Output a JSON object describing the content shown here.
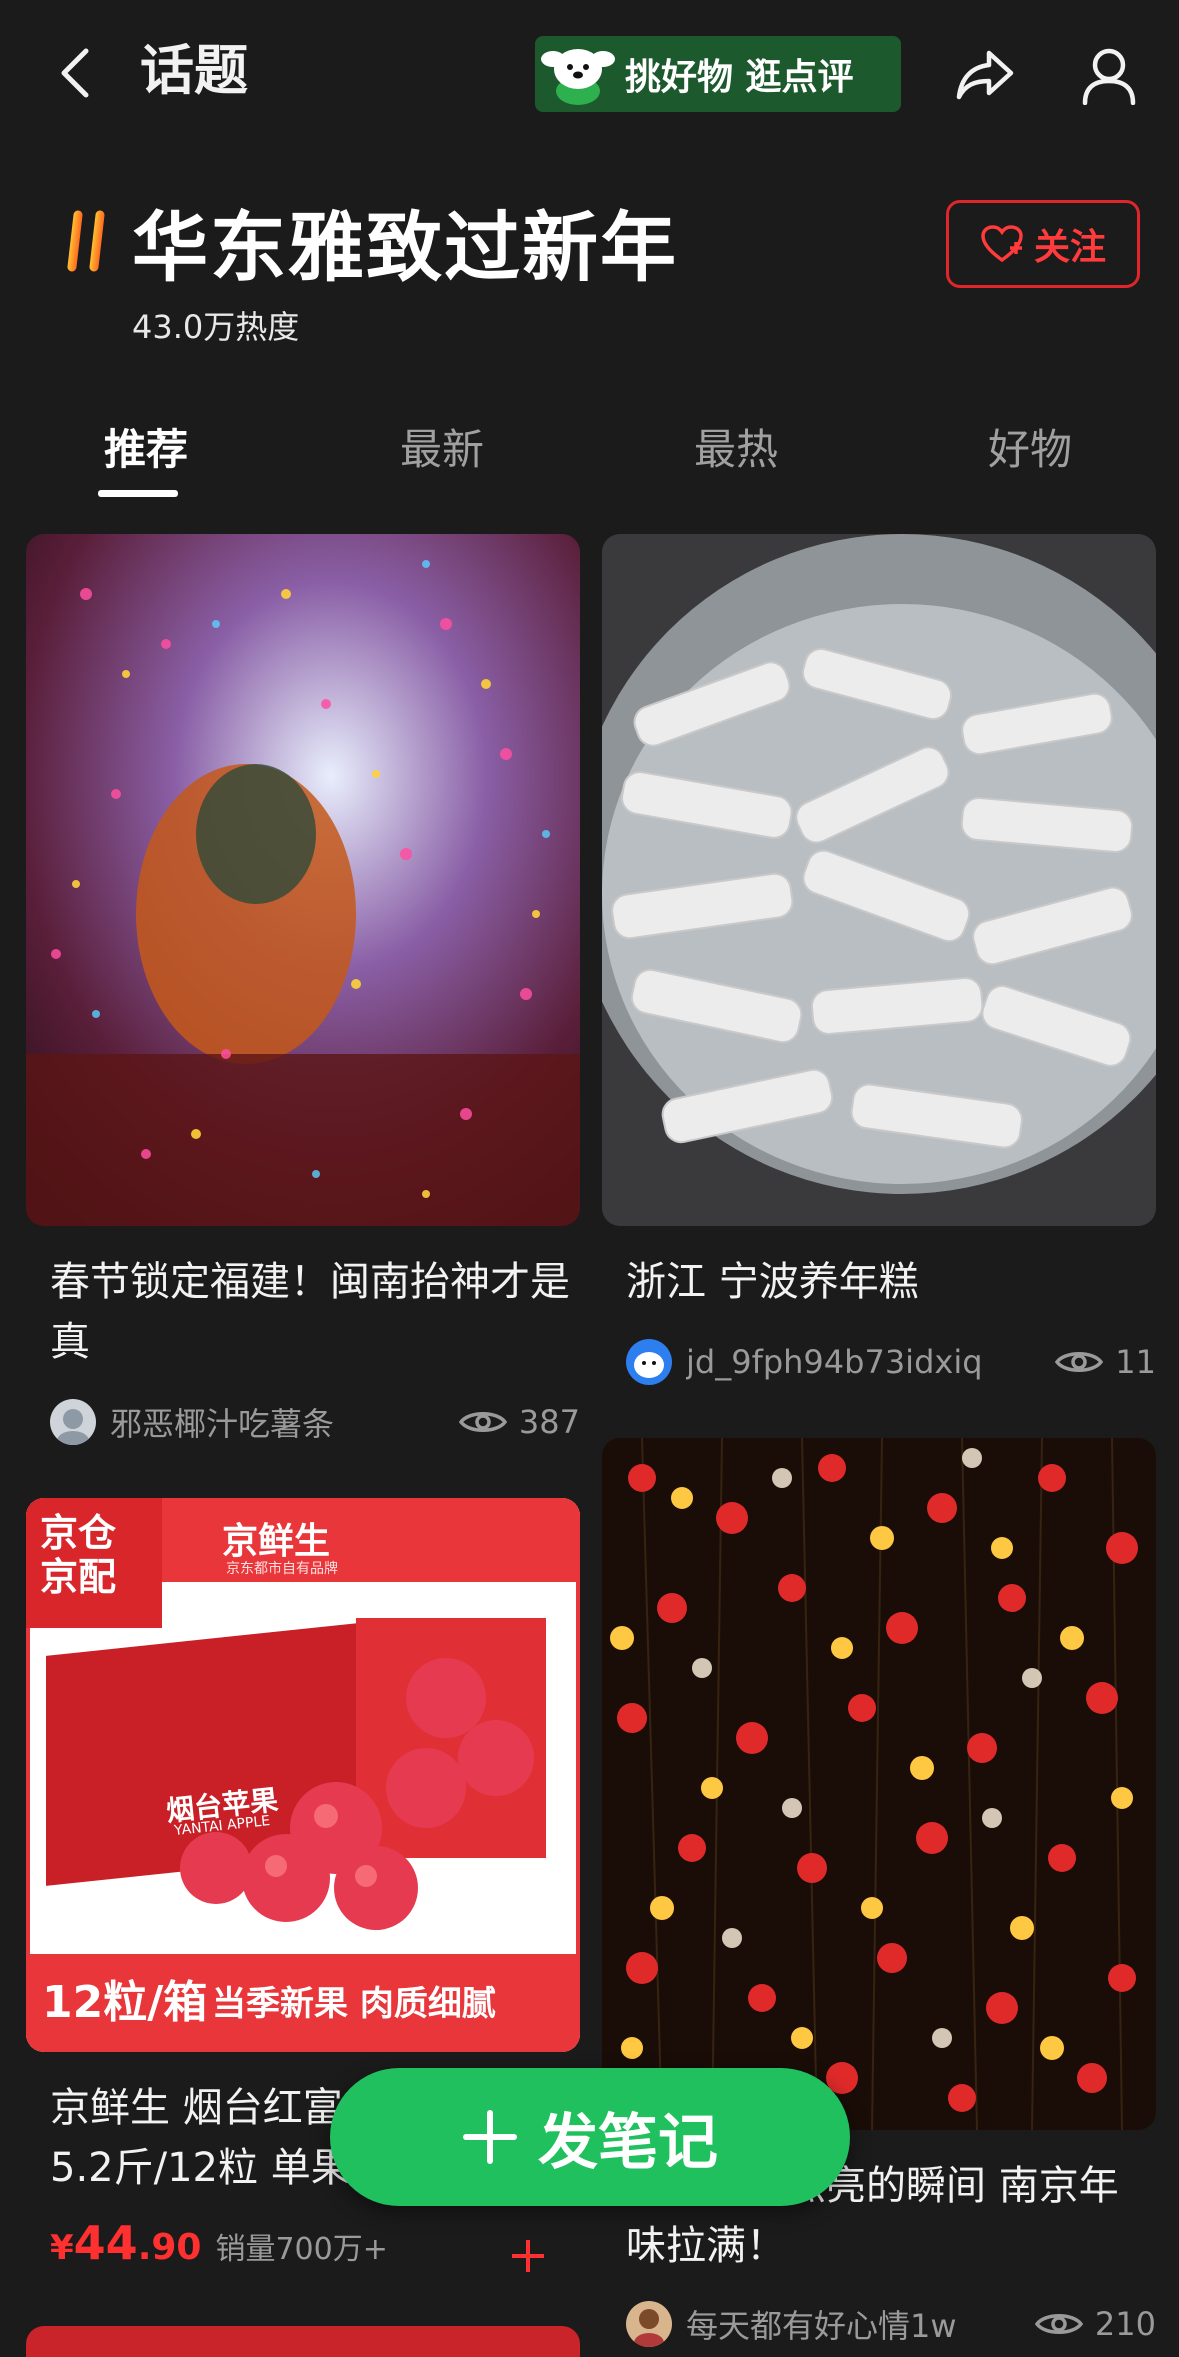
{
  "header": {
    "title": "话题",
    "promo_text": "挑好物 逛点评"
  },
  "topic": {
    "name": "华东雅致过新年",
    "heat": "43.0万热度",
    "follow_label": "关注"
  },
  "tabs": [
    {
      "label": "推荐",
      "active": true
    },
    {
      "label": "最新",
      "active": false
    },
    {
      "label": "最热",
      "active": false
    },
    {
      "label": "好物",
      "active": false
    }
  ],
  "cards": {
    "c1": {
      "title": "春节锁定福建！闽南抬神才是真",
      "author": "邪恶椰汁吃薯条",
      "views": "387"
    },
    "c2": {
      "title": "浙江 宁波养年糕",
      "author": "jd_9fph94b73idxiq",
      "views": "11"
    },
    "c3": {
      "title": "京鲜生 烟台红富士苹果 净重5.2斤/12粒 单果",
      "price_symbol": "¥",
      "price_int": "44",
      "price_dec": ".90",
      "sales": "销量700万+",
      "badge_top": "京仓",
      "badge_bottom": "京配",
      "brand": "京鲜生",
      "brand_sub": "京东都市自有品牌",
      "box_label": "烟台苹果",
      "box_label_en": "YANTAI APPLE",
      "count": "12粒/箱",
      "slogan": "当季新果 肉质细腻"
    },
    "c4": {
      "title": "那些花灯点亮的瞬间 南京年味拉满！",
      "author": "每天都有好心情1w",
      "views": "210"
    }
  },
  "fab": {
    "label": "发笔记"
  },
  "colors": {
    "background": "#1b1b1b",
    "accent_green": "#21c05f",
    "accent_red": "#e0262b"
  }
}
